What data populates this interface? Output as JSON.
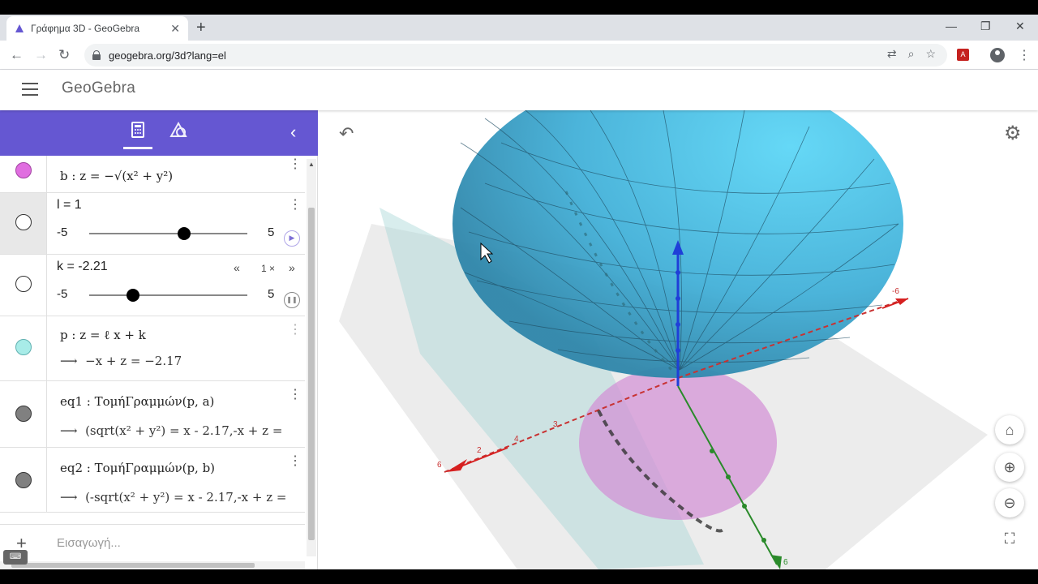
{
  "browser": {
    "tab_title": "Γράφημα 3D - GeoGebra",
    "tab_close": "✕",
    "new_tab": "+",
    "url": "geogebra.org/3d?lang=el",
    "win_min": "—",
    "win_restore": "❐",
    "win_close": "✕"
  },
  "app": {
    "logo": "GeoGebra"
  },
  "algebra": {
    "rows": [
      {
        "id": "b",
        "text": "b : z = −√(x² + y²)",
        "marble_color": "#e06ee0"
      },
      {
        "id": "l",
        "text": "l = 1",
        "min": "-5",
        "max": "5",
        "value": 1,
        "range": [
          -5,
          5
        ]
      },
      {
        "id": "k",
        "text": "k = -2.21",
        "min": "-5",
        "max": "5",
        "value": -2.21,
        "range": [
          -5,
          5
        ],
        "speed": "1 ×"
      },
      {
        "id": "p",
        "text": "p : z = ℓ x + k",
        "output": "−x + z = −2.17",
        "marble_color": "#a8ece8"
      },
      {
        "id": "eq1",
        "text": "eq1 : ΤομήΓραμμών(p, a)",
        "output": "(sqrt(x² + y²) = x - 2.17,-x + z =",
        "marble_color": "#808080"
      },
      {
        "id": "eq2",
        "text": "eq2 : ΤομήΓραμμών(p, b)",
        "output": "(-sqrt(x² + y²) = x - 2.17,-x + z =",
        "marble_color": "#808080"
      }
    ],
    "input_placeholder": "Εισαγωγή...",
    "arrow": "⟶"
  },
  "axes": {
    "x_labels": [
      "6",
      "4",
      "3",
      "2"
    ],
    "y_labels": [
      "-6"
    ],
    "z_labels": [
      "6"
    ]
  }
}
